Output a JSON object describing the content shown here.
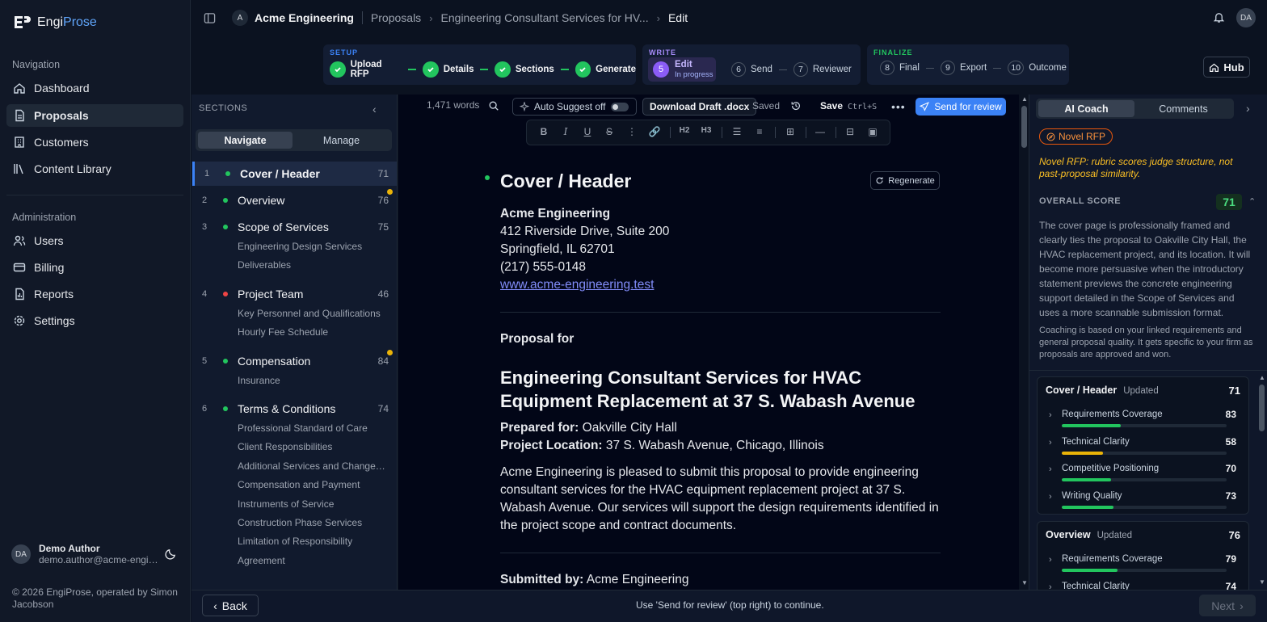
{
  "brand": {
    "part1": "Engi",
    "part2": "Prose"
  },
  "nav": {
    "header": "Navigation",
    "items": [
      {
        "label": "Dashboard",
        "icon": "dashboard-icon"
      },
      {
        "label": "Proposals",
        "icon": "file-icon"
      },
      {
        "label": "Customers",
        "icon": "building-icon"
      },
      {
        "label": "Content Library",
        "icon": "library-icon"
      }
    ],
    "admin_header": "Administration",
    "admin_items": [
      {
        "label": "Users",
        "icon": "users-icon"
      },
      {
        "label": "Billing",
        "icon": "credit-card-icon"
      },
      {
        "label": "Reports",
        "icon": "report-icon"
      },
      {
        "label": "Settings",
        "icon": "gear-icon"
      }
    ]
  },
  "user": {
    "initials": "DA",
    "name": "Demo Author",
    "email": "demo.author@acme-engineering.test"
  },
  "copyright": "© 2026 EngiProse, operated by Simon Jacobson",
  "topbar": {
    "org_initial": "A",
    "org": "Acme Engineering",
    "crumb1": "Proposals",
    "crumb2": "Engineering Consultant Services for HV...",
    "crumb3": "Edit",
    "user_initials": "DA"
  },
  "stepper": {
    "setup_label": "SETUP",
    "setup_steps": [
      "Upload RFP",
      "Details",
      "Sections",
      "Generate"
    ],
    "write_label": "WRITE",
    "active": {
      "num": "5",
      "label": "Edit",
      "sub": "In progress"
    },
    "write_steps": [
      {
        "num": "6",
        "label": "Send"
      },
      {
        "num": "7",
        "label": "Reviewer"
      }
    ],
    "finalize_label": "FINALIZE",
    "finalize_steps": [
      {
        "num": "8",
        "label": "Final"
      },
      {
        "num": "9",
        "label": "Export"
      },
      {
        "num": "10",
        "label": "Outcome"
      }
    ],
    "hub": "Hub"
  },
  "sections_panel": {
    "title": "SECTIONS",
    "tab_navigate": "Navigate",
    "tab_manage": "Manage",
    "sections": [
      {
        "num": "1",
        "title": "Cover / Header",
        "score": "71",
        "status": "#22c55e",
        "badge": false,
        "subs": []
      },
      {
        "num": "2",
        "title": "Overview",
        "score": "76",
        "status": "#22c55e",
        "badge": true,
        "subs": []
      },
      {
        "num": "3",
        "title": "Scope of Services",
        "score": "75",
        "status": "#22c55e",
        "badge": false,
        "subs": [
          "Engineering Design Services",
          "Deliverables"
        ]
      },
      {
        "num": "4",
        "title": "Project Team",
        "score": "46",
        "status": "#ef4444",
        "badge": false,
        "subs": [
          "Key Personnel and Qualifications",
          "Hourly Fee Schedule"
        ]
      },
      {
        "num": "5",
        "title": "Compensation",
        "score": "84",
        "status": "#22c55e",
        "badge": true,
        "subs": [
          "Insurance"
        ]
      },
      {
        "num": "6",
        "title": "Terms & Conditions",
        "score": "74",
        "status": "#22c55e",
        "badge": false,
        "subs": [
          "Professional Standard of Care",
          "Client Responsibilities",
          "Additional Services and Changes in Scope",
          "Compensation and Payment",
          "Instruments of Service",
          "Construction Phase Services",
          "Limitation of Responsibility",
          "Agreement"
        ]
      }
    ]
  },
  "editor": {
    "word_count": "1,471 words",
    "auto_suggest": "Auto Suggest off",
    "download": "Download Draft .docx",
    "saved": "Saved",
    "save": "Save",
    "save_shortcut": "Ctrl+S",
    "send": "Send for review",
    "regenerate": "Regenerate",
    "h2": "H2",
    "h3": "H3",
    "doc": {
      "heading": "Cover / Header",
      "company": "Acme Engineering",
      "address1": "412 Riverside Drive, Suite 200",
      "address2": "Springfield, IL 62701",
      "phone": "(217) 555-0148",
      "website": "www.acme-engineering.test",
      "proposal_for": "Proposal for",
      "title": "Engineering Consultant Services for HVAC Equipment Replacement at 37 S. Wabash Avenue",
      "prepared_label": "Prepared for:",
      "prepared_value": "Oakville City Hall",
      "location_label": "Project Location:",
      "location_value": "37 S. Wabash Avenue, Chicago, Illinois",
      "intro": "Acme Engineering is pleased to submit this proposal to provide engineering consultant services for the HVAC equipment replacement project at 37 S. Wabash Avenue. Our services will support the design requirements identified in the project scope and contract documents.",
      "submitted_label": "Submitted by:",
      "submitted_value": "Acme Engineering"
    }
  },
  "coach": {
    "tab_ai": "AI Coach",
    "tab_comments": "Comments",
    "novel_badge": "Novel RFP",
    "novel_note": "Novel RFP: rubric scores judge structure, not past-proposal similarity.",
    "overall_label": "OVERALL SCORE",
    "overall_score": "71",
    "overall_text": "The cover page is professionally framed and clearly ties the proposal to Oakville City Hall, the HVAC replacement project, and its location. It will become more persuasive when the introductory statement previews the concrete engineering support detailed in the Scope of Services and uses a more scannable submission format.",
    "coaching_note": "Coaching is based on your linked requirements and general proposal quality. It gets specific to your firm as proposals are approved and won.",
    "cards": [
      {
        "title": "Cover / Header",
        "status": "Updated",
        "score": "71",
        "criteria": [
          {
            "name": "Requirements Coverage",
            "value": 83,
            "color": "#22c55e"
          },
          {
            "name": "Technical Clarity",
            "value": 58,
            "color": "#eab308"
          },
          {
            "name": "Competitive Positioning",
            "value": 70,
            "color": "#22c55e"
          },
          {
            "name": "Writing Quality",
            "value": 73,
            "color": "#22c55e"
          }
        ]
      },
      {
        "title": "Overview",
        "status": "Updated",
        "score": "76",
        "criteria": [
          {
            "name": "Requirements Coverage",
            "value": 79,
            "color": "#22c55e"
          },
          {
            "name": "Technical Clarity",
            "value": 74,
            "color": "#22c55e"
          }
        ]
      }
    ]
  },
  "footer": {
    "back": "Back",
    "hint": "Use 'Send for review' (top right) to continue.",
    "next": "Next"
  }
}
